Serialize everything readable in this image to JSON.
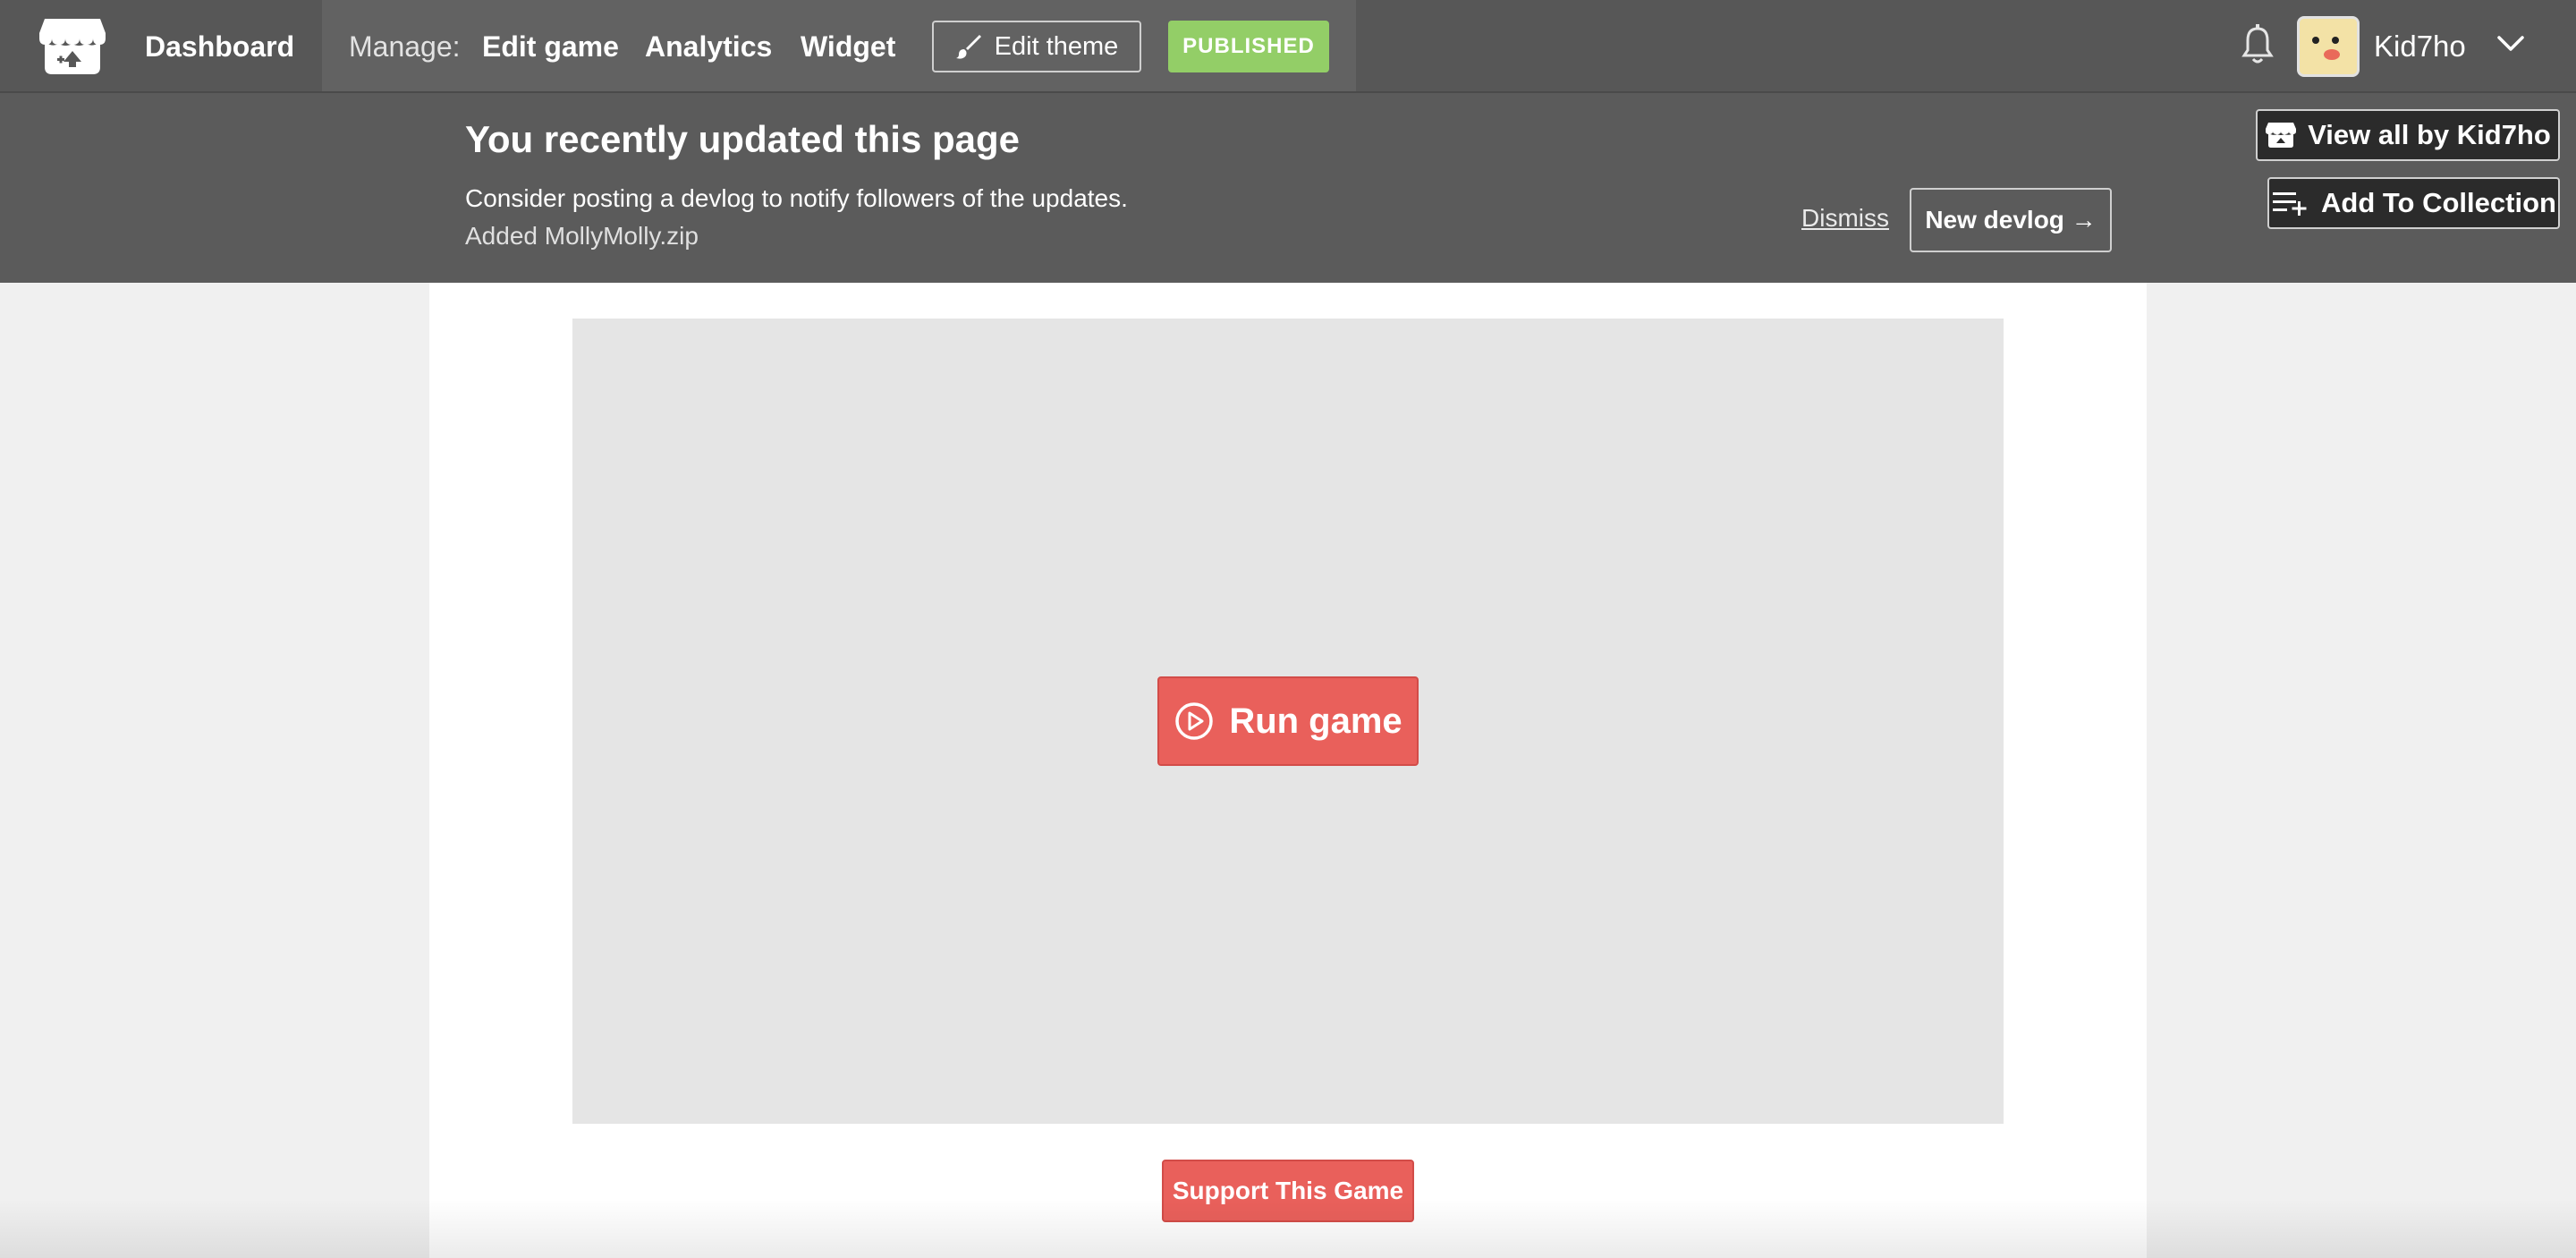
{
  "header": {
    "dashboard_label": "Dashboard",
    "manage_label": "Manage:",
    "nav": {
      "edit_game": "Edit game",
      "analytics": "Analytics",
      "widget": "Widget"
    },
    "edit_theme_label": "Edit theme",
    "published_label": "PUBLISHED",
    "username": "Kid7ho",
    "icons": [
      "itchio-logo-icon",
      "brush-icon",
      "bell-icon",
      "chevron-down-icon"
    ]
  },
  "banner": {
    "title": "You recently updated this page",
    "message": "Consider posting a devlog to notify followers of the updates.",
    "change": "Added MollyMolly.zip",
    "dismiss_label": "Dismiss",
    "new_devlog_label": "New devlog →",
    "view_all_label": "View all by Kid7ho",
    "add_collection_label": "Add To Collection"
  },
  "game": {
    "run_label": "Run game",
    "support_label": "Support This Game"
  },
  "colors": {
    "header_bg": "#575757",
    "banner_bg": "#5b5b5b",
    "accent_red": "#e9605b",
    "published_green": "#93ce67",
    "frame_bg": "#e5e5e5"
  }
}
